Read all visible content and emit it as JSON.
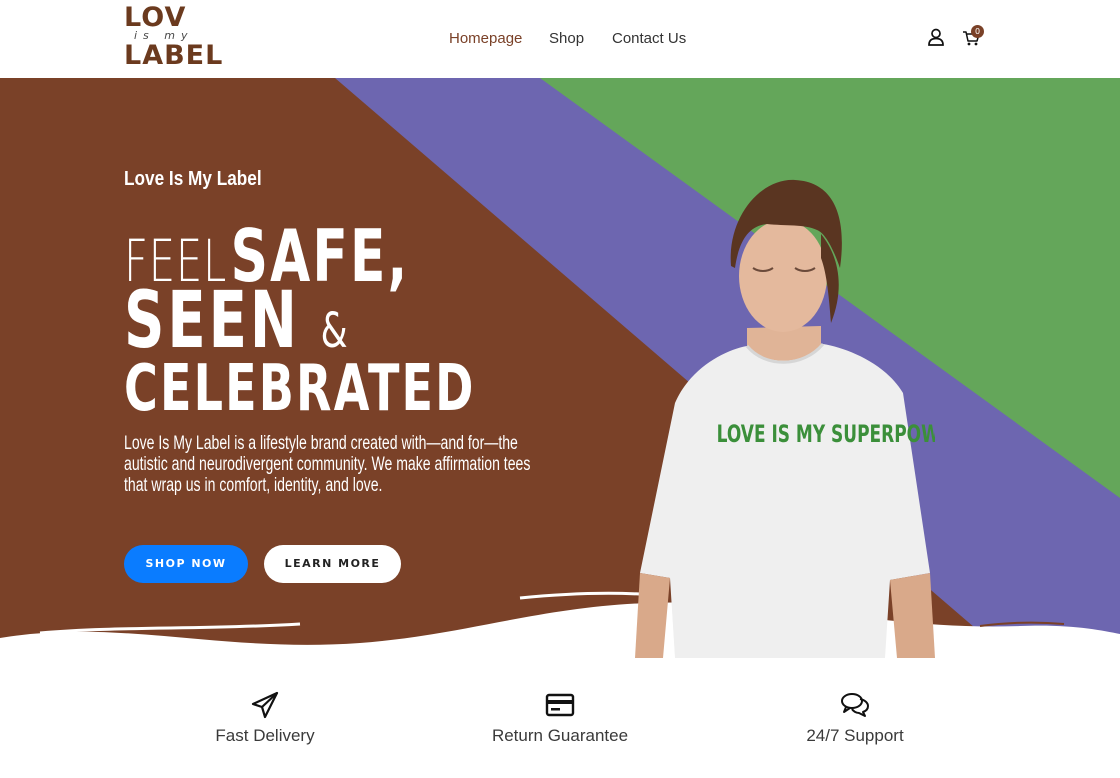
{
  "header": {
    "logo": {
      "line1": "LOV",
      "line2": "is my",
      "line3": "LABEL"
    },
    "nav": [
      {
        "label": "Homepage",
        "active": true
      },
      {
        "label": "Shop",
        "active": false
      },
      {
        "label": "Contact Us",
        "active": false
      }
    ],
    "icons": {
      "account": "user-icon",
      "cart": "cart-icon"
    },
    "cart_count": "0"
  },
  "hero": {
    "eyebrow": "Love Is My Label",
    "headline": {
      "row1_light": "FEEL",
      "row1_bold": "SAFE,",
      "row2_bold": "SEEN",
      "row2_amp": "&",
      "row3_bold": "CELEBRATED"
    },
    "description": "Love Is My Label is a lifestyle brand created with—and for—the autistic and neurodivergent community. We make affirmation tees that wrap us in comfort, identity, and love.",
    "buttons": {
      "shop": "SHOP NOW",
      "learn": "LEARN MORE"
    },
    "shirt_text": "LOVE IS MY SUPERPOWER",
    "colors": {
      "brown": "#7a4128",
      "purple": "#6d66b0",
      "green": "#64a65a",
      "blue_button": "#0a7cff"
    }
  },
  "features": [
    {
      "label": "Fast Delivery",
      "icon": "paper-plane-icon"
    },
    {
      "label": "Return Guarantee",
      "icon": "credit-card-icon"
    },
    {
      "label": "24/7 Support",
      "icon": "chat-bubbles-icon"
    }
  ]
}
